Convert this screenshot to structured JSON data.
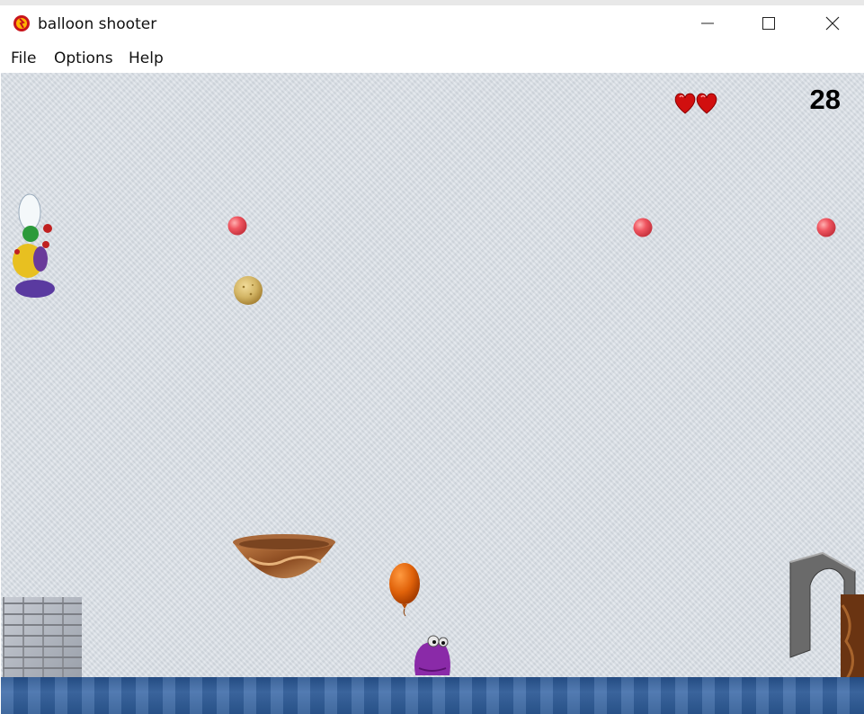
{
  "window": {
    "title": "balloon shooter",
    "controls": {
      "minimize": "—",
      "maximize": "☐",
      "close": "✕"
    }
  },
  "menu": {
    "items": [
      "File",
      "Options",
      "Help"
    ]
  },
  "hud": {
    "score": "28",
    "lives": 2
  },
  "colors": {
    "background": "#d8dee5",
    "target": "#e8505a",
    "balloon": "#e0620a",
    "water": "#2f5c98",
    "heart": "#d91010"
  },
  "icons": {
    "app": "game-icon",
    "heart": "heart-icon"
  }
}
